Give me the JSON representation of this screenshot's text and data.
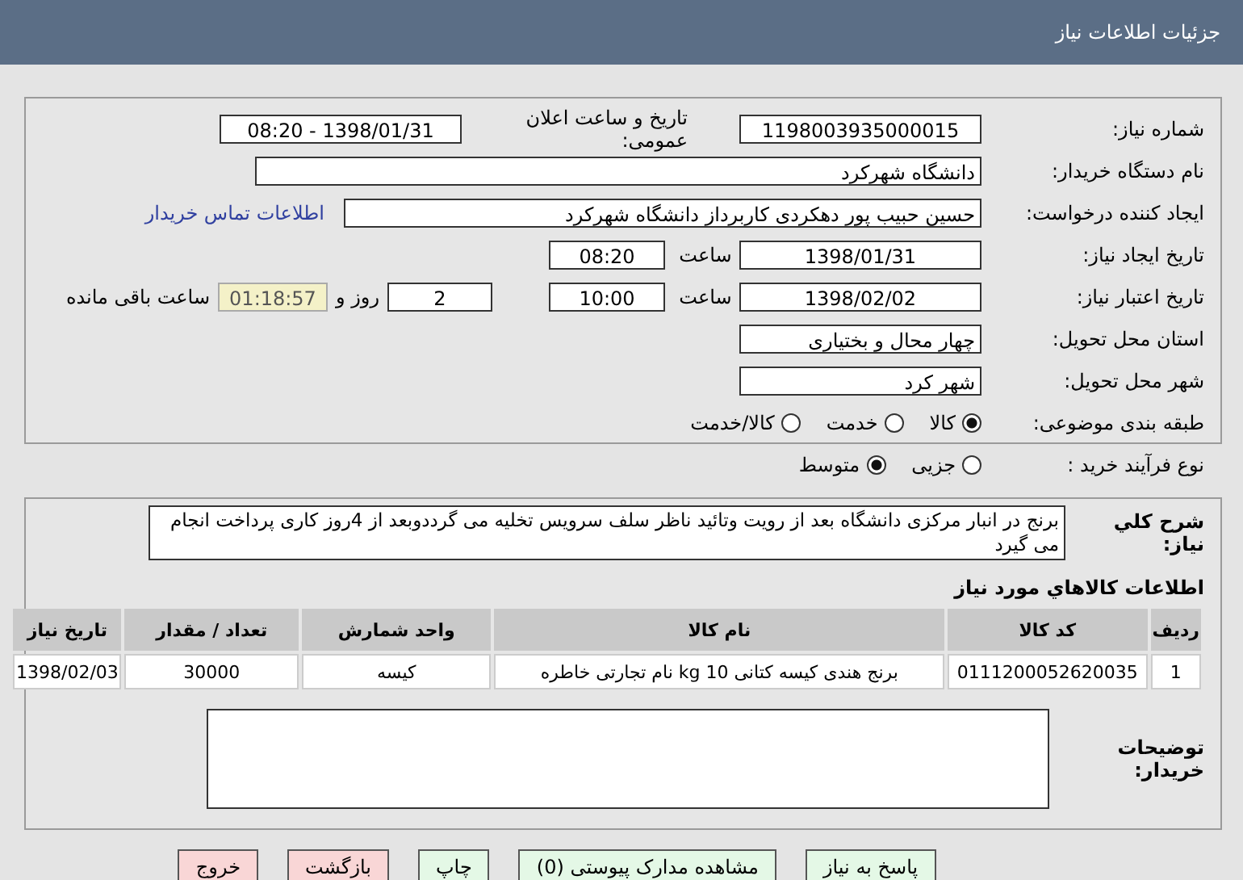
{
  "header": {
    "title": "جزئیات اطلاعات نیاز"
  },
  "need_number": {
    "label": "شماره نیاز:",
    "value": "1198003935000015"
  },
  "announce": {
    "label": "تاریخ و ساعت اعلان عمومی:",
    "value": "1398/01/31 - 08:20"
  },
  "buyer_org": {
    "label": "نام دستگاه خریدار:",
    "value": "دانشگاه شهرکرد"
  },
  "requester": {
    "label": "ایجاد کننده درخواست:",
    "value": "حسین حبیب پور دهکردی کاربرداز دانشگاه شهرکرد",
    "link": "اطلاعات تماس خریدار"
  },
  "created": {
    "label": "تاریخ ایجاد نیاز:",
    "date": "1398/01/31",
    "time_label": "ساعت",
    "time": "08:20"
  },
  "validity": {
    "label": "تاریخ اعتبار نیاز:",
    "date": "1398/02/02",
    "time_label": "ساعت",
    "time": "10:00",
    "days": "2",
    "days_label": "روز و",
    "remaining": "01:18:57",
    "remaining_label": "ساعت باقی مانده"
  },
  "province": {
    "label": "استان محل تحویل:",
    "value": "چهار محال و بختیاری"
  },
  "city": {
    "label": "شهر محل تحویل:",
    "value": "شهر کرد"
  },
  "category": {
    "label": "طبقه بندی موضوعی:",
    "options": [
      {
        "label": "کالا",
        "selected": true
      },
      {
        "label": "خدمت",
        "selected": false
      },
      {
        "label": "کالا/خدمت",
        "selected": false
      }
    ]
  },
  "process": {
    "label": "نوع فرآیند خرید :",
    "options": [
      {
        "label": "جزیی",
        "selected": false
      },
      {
        "label": "متوسط",
        "selected": true
      }
    ]
  },
  "description": {
    "label": "شرح کلي نياز:",
    "value": "برنج در انبار مرکزی دانشگاه بعد از رویت وتائید ناظر سلف سرویس تخلیه می گرددوبعد از 4روز کاری پرداخت انجام می گیرد"
  },
  "goods": {
    "title": "اطلاعات کالاهاي مورد نياز",
    "columns": [
      "رديف",
      "کد کالا",
      "نام کالا",
      "واحد شمارش",
      "تعداد / مقدار",
      "تاریخ نیاز"
    ],
    "rows": [
      [
        "1",
        "0111200052620035",
        "برنج هندی کیسه کتانی 10 kg نام تجارتی خاطره",
        "کیسه",
        "30000",
        "1398/02/03"
      ]
    ]
  },
  "buyer_notes": {
    "label": "توضیحات خریدار:"
  },
  "buttons": [
    {
      "label": "پاسخ به نیاز",
      "kind": "green"
    },
    {
      "label": "مشاهده مدارک پیوستی (0)",
      "kind": "green"
    },
    {
      "label": "چاپ",
      "kind": "green"
    },
    {
      "label": "بازگشت",
      "kind": "red"
    },
    {
      "label": "خروج",
      "kind": "red"
    }
  ]
}
